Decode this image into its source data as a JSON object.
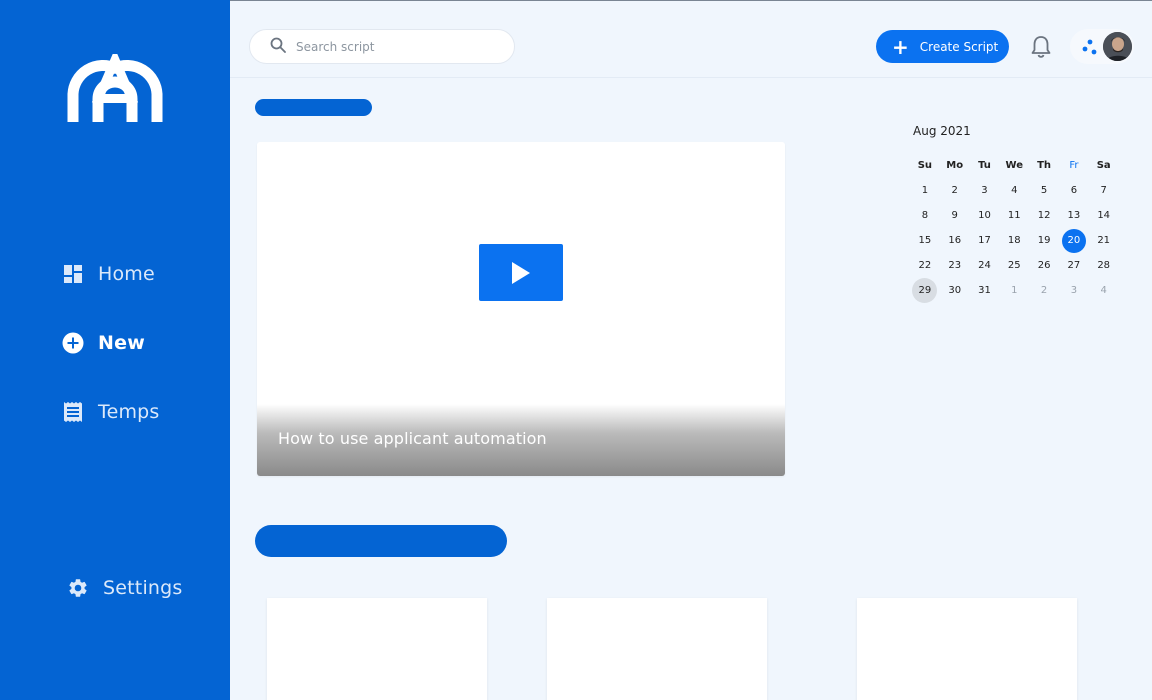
{
  "search": {
    "placeholder": "Search script",
    "value": ""
  },
  "toolbar": {
    "create_label": "Create Script"
  },
  "sidebar": {
    "items": [
      {
        "label": "Home",
        "icon": "dashboard-icon"
      },
      {
        "label": "New",
        "icon": "plus-circle-icon",
        "active": true
      },
      {
        "label": "Temps",
        "icon": "template-icon"
      }
    ],
    "settings_label": "Settings"
  },
  "video": {
    "title": "How to use applicant automation"
  },
  "calendar": {
    "title": "Aug 2021",
    "weekdays": [
      "Su",
      "Mo",
      "Tu",
      "We",
      "Th",
      "Fr",
      "Sa"
    ],
    "weeks": [
      [
        "1",
        "2",
        "3",
        "4",
        "5",
        "6",
        "7"
      ],
      [
        "8",
        "9",
        "10",
        "11",
        "12",
        "13",
        "14"
      ],
      [
        "15",
        "16",
        "17",
        "18",
        "19",
        "20",
        "21"
      ],
      [
        "22",
        "23",
        "24",
        "25",
        "26",
        "27",
        "28"
      ],
      [
        "29",
        "30",
        "31",
        "1",
        "2",
        "3",
        "4"
      ]
    ],
    "selected": "20",
    "today": "29",
    "highlight_weekday": "Fr"
  },
  "colors": {
    "brand": "#0464d3",
    "accent": "#0b72f0",
    "background": "#f0f6fd"
  }
}
